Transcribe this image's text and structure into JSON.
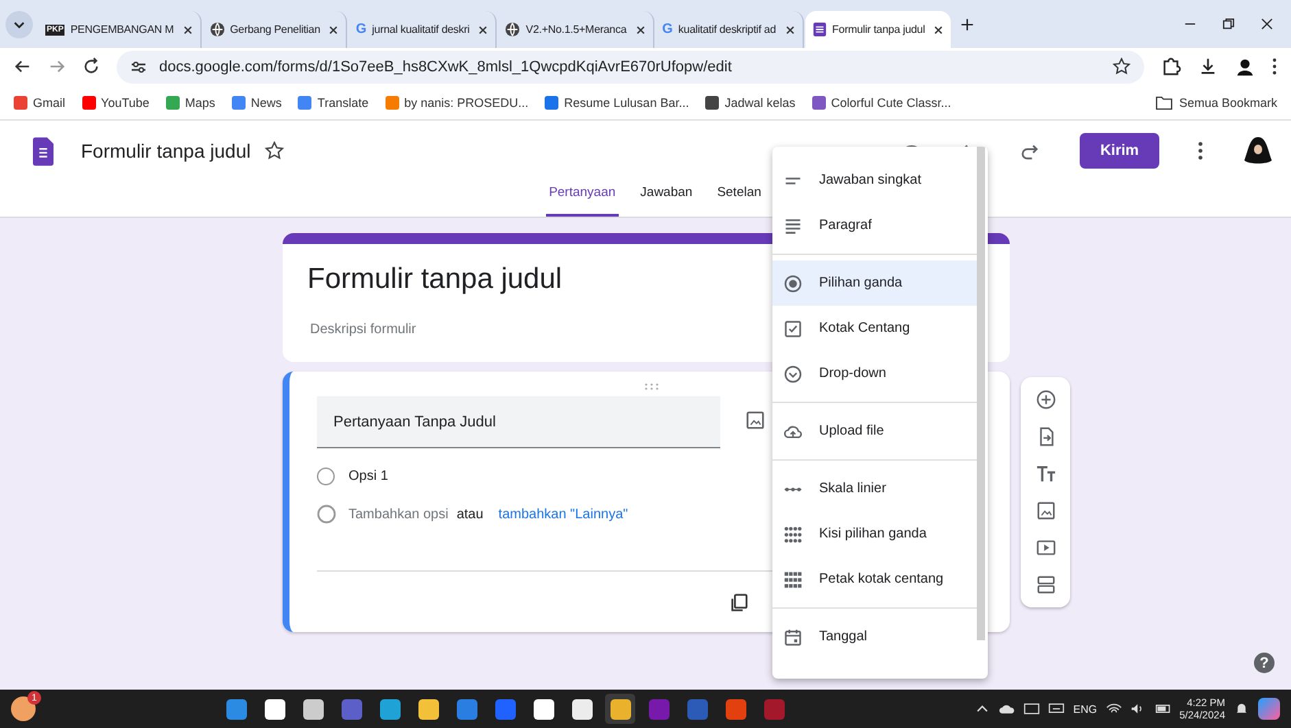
{
  "browser": {
    "tabs": [
      {
        "kind": "pkp",
        "favicon_label": "PKP",
        "title": "PENGEMBANGAN M",
        "selected": false
      },
      {
        "kind": "globe",
        "title": "Gerbang Penelitian",
        "selected": false
      },
      {
        "kind": "google",
        "favicon_label": "G",
        "title": "jurnal kualitatif deskri",
        "selected": false
      },
      {
        "kind": "globe",
        "title": "V2.+No.1.5+Meranca",
        "selected": false
      },
      {
        "kind": "google",
        "favicon_label": "G",
        "title": "kualitatif deskriptif ad",
        "selected": false
      },
      {
        "kind": "forms",
        "title": "Formulir tanpa judul",
        "selected": true
      }
    ],
    "url": "docs.google.com/forms/d/1So7eeB_hs8CXwK_8mlsl_1QwcpdKqiAvrE670rUfopw/edit",
    "bookmarks": [
      "Gmail",
      "YouTube",
      "Maps",
      "News",
      "Translate",
      "by nanis: PROSEDU...",
      "Resume Lulusan Bar...",
      "Jadwal kelas",
      "Colorful Cute Classr..."
    ],
    "all_bookmarks": "Semua Bookmark"
  },
  "header": {
    "title": "Formulir tanpa judul",
    "send": "Kirim",
    "tabs": [
      {
        "label": "Pertanyaan",
        "selected": true
      },
      {
        "label": "Jawaban",
        "selected": false
      },
      {
        "label": "Setelan",
        "selected": false
      }
    ]
  },
  "form": {
    "title": "Formulir tanpa judul",
    "description_placeholder": "Deskripsi formulir",
    "question": {
      "placeholder": "Pertanyaan Tanpa Judul",
      "options": [
        {
          "label": "Opsi 1",
          "selected": false
        }
      ],
      "add_option": "Tambahkan opsi",
      "or": "atau",
      "add_other": "tambahkan \"Lainnya\""
    }
  },
  "type_menu": [
    [
      {
        "kind": "short",
        "label": "Jawaban singkat",
        "selected": false
      },
      {
        "kind": "paragraph",
        "label": "Paragraf",
        "selected": false
      }
    ],
    [
      {
        "kind": "radio",
        "label": "Pilihan ganda",
        "selected": true
      },
      {
        "kind": "checkbox",
        "label": "Kotak Centang",
        "selected": false
      },
      {
        "kind": "dropdown",
        "label": "Drop-down",
        "selected": false
      }
    ],
    [
      {
        "kind": "upload",
        "label": "Upload file",
        "selected": false
      }
    ],
    [
      {
        "kind": "scale",
        "label": "Skala linier",
        "selected": false
      },
      {
        "kind": "grid",
        "label": "Kisi pilihan ganda",
        "selected": false
      },
      {
        "kind": "checkgrid",
        "label": "Petak kotak centang",
        "selected": false
      }
    ],
    [
      {
        "kind": "date",
        "label": "Tanggal",
        "selected": false
      }
    ]
  ],
  "help": "?",
  "taskbar": {
    "notification_count": "1",
    "language": "ENG",
    "time": "4:22 PM",
    "date": "5/24/2024"
  }
}
